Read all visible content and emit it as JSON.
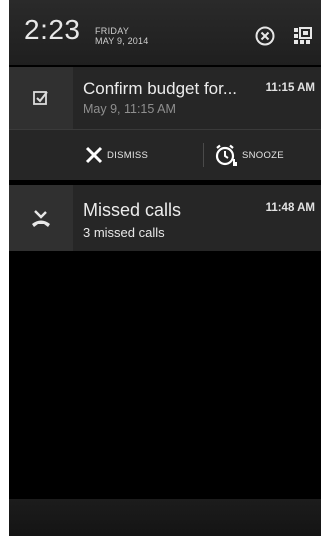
{
  "header": {
    "time": "2:23",
    "day": "FRIDAY",
    "date": "MAY 9, 2014",
    "clear_icon": "clear-all-icon",
    "grid_icon": "quick-settings-icon"
  },
  "notifications": [
    {
      "icon": "checkbox-task-icon",
      "title": "Confirm budget for...",
      "subtitle": "May 9, 11:15 AM",
      "time": "11:15 AM",
      "actions": [
        {
          "icon": "close-icon",
          "label": "DISMISS"
        },
        {
          "icon": "alarm-snooze-icon",
          "label": "SNOOZE"
        }
      ]
    },
    {
      "icon": "missed-call-icon",
      "title": "Missed calls",
      "subtitle": "3 missed calls",
      "time": "11:48 AM"
    }
  ],
  "colors": {
    "panel": "#262626",
    "icon_box": "#303030",
    "background": "#000000",
    "header": "#222222"
  }
}
